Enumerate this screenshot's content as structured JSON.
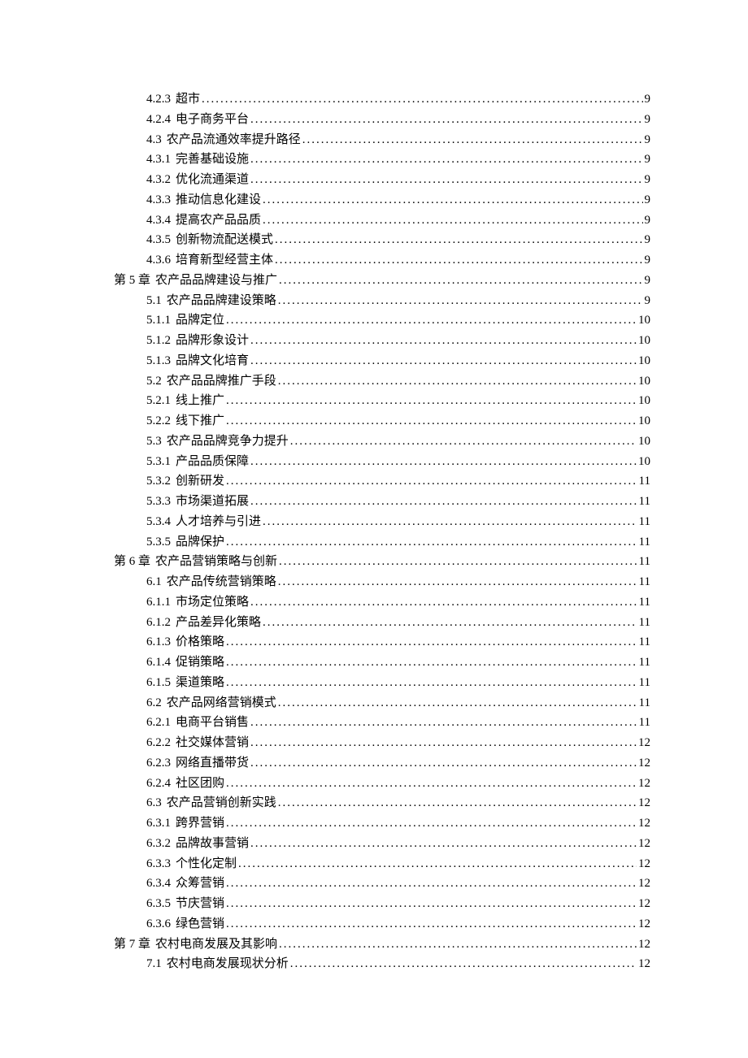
{
  "toc": [
    {
      "level": 3,
      "num": "4.2.3",
      "title": "超市",
      "page": "9"
    },
    {
      "level": 3,
      "num": "4.2.4",
      "title": "电子商务平台",
      "page": "9"
    },
    {
      "level": 2,
      "num": "4.3",
      "title": "农产品流通效率提升路径",
      "page": "9"
    },
    {
      "level": 3,
      "num": "4.3.1",
      "title": "完善基础设施",
      "page": "9"
    },
    {
      "level": 3,
      "num": "4.3.2",
      "title": "优化流通渠道",
      "page": "9"
    },
    {
      "level": 3,
      "num": "4.3.3",
      "title": "推动信息化建设",
      "page": "9"
    },
    {
      "level": 3,
      "num": "4.3.4",
      "title": "提高农产品品质",
      "page": "9"
    },
    {
      "level": 3,
      "num": "4.3.5",
      "title": "创新物流配送模式",
      "page": "9"
    },
    {
      "level": 3,
      "num": "4.3.6",
      "title": "培育新型经营主体",
      "page": "9"
    },
    {
      "level": 1,
      "num": "第 5 章",
      "title": "农产品品牌建设与推广",
      "page": "9"
    },
    {
      "level": 2,
      "num": "5.1",
      "title": "农产品品牌建设策略",
      "page": "9"
    },
    {
      "level": 3,
      "num": "5.1.1",
      "title": "品牌定位",
      "page": "10"
    },
    {
      "level": 3,
      "num": "5.1.2",
      "title": "品牌形象设计",
      "page": "10"
    },
    {
      "level": 3,
      "num": "5.1.3",
      "title": "品牌文化培育",
      "page": "10"
    },
    {
      "level": 2,
      "num": "5.2",
      "title": "农产品品牌推广手段",
      "page": "10"
    },
    {
      "level": 3,
      "num": "5.2.1",
      "title": "线上推广",
      "page": "10"
    },
    {
      "level": 3,
      "num": "5.2.2",
      "title": "线下推广",
      "page": "10"
    },
    {
      "level": 2,
      "num": "5.3",
      "title": "农产品品牌竞争力提升",
      "page": "10"
    },
    {
      "level": 3,
      "num": "5.3.1",
      "title": "产品品质保障",
      "page": "10"
    },
    {
      "level": 3,
      "num": "5.3.2",
      "title": "创新研发",
      "page": "11"
    },
    {
      "level": 3,
      "num": "5.3.3",
      "title": "市场渠道拓展",
      "page": "11"
    },
    {
      "level": 3,
      "num": "5.3.4",
      "title": "人才培养与引进",
      "page": "11"
    },
    {
      "level": 3,
      "num": "5.3.5",
      "title": "品牌保护",
      "page": "11"
    },
    {
      "level": 1,
      "num": "第 6 章",
      "title": "农产品营销策略与创新",
      "page": "11"
    },
    {
      "level": 2,
      "num": "6.1",
      "title": "农产品传统营销策略",
      "page": "11"
    },
    {
      "level": 3,
      "num": "6.1.1",
      "title": "市场定位策略",
      "page": "11"
    },
    {
      "level": 3,
      "num": "6.1.2",
      "title": "产品差异化策略",
      "page": "11"
    },
    {
      "level": 3,
      "num": "6.1.3",
      "title": "价格策略",
      "page": "11"
    },
    {
      "level": 3,
      "num": "6.1.4",
      "title": "促销策略",
      "page": "11"
    },
    {
      "level": 3,
      "num": "6.1.5",
      "title": "渠道策略",
      "page": "11"
    },
    {
      "level": 2,
      "num": "6.2",
      "title": "农产品网络营销模式",
      "page": "11"
    },
    {
      "level": 3,
      "num": "6.2.1",
      "title": "电商平台销售",
      "page": "11"
    },
    {
      "level": 3,
      "num": "6.2.2",
      "title": "社交媒体营销",
      "page": "12"
    },
    {
      "level": 3,
      "num": "6.2.3",
      "title": "网络直播带货",
      "page": "12"
    },
    {
      "level": 3,
      "num": "6.2.4",
      "title": "社区团购",
      "page": "12"
    },
    {
      "level": 2,
      "num": "6.3",
      "title": "农产品营销创新实践",
      "page": "12"
    },
    {
      "level": 3,
      "num": "6.3.1",
      "title": "跨界营销",
      "page": "12"
    },
    {
      "level": 3,
      "num": "6.3.2",
      "title": "品牌故事营销",
      "page": "12"
    },
    {
      "level": 3,
      "num": "6.3.3",
      "title": "个性化定制",
      "page": "12"
    },
    {
      "level": 3,
      "num": "6.3.4",
      "title": "众筹营销",
      "page": "12"
    },
    {
      "level": 3,
      "num": "6.3.5",
      "title": "节庆营销",
      "page": "12"
    },
    {
      "level": 3,
      "num": "6.3.6",
      "title": "绿色营销",
      "page": "12"
    },
    {
      "level": 1,
      "num": "第 7 章",
      "title": "农村电商发展及其影响",
      "page": "12"
    },
    {
      "level": 2,
      "num": "7.1",
      "title": "农村电商发展现状分析",
      "page": "12"
    }
  ]
}
